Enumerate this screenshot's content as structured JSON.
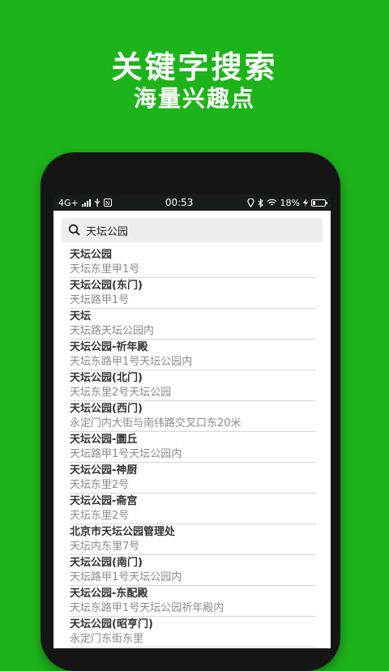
{
  "promo": {
    "headline": "关键字搜索",
    "subline": "海量兴趣点"
  },
  "statusbar": {
    "network": "4G+",
    "time": "00:53",
    "battery": "18%",
    "app_badge": "N"
  },
  "search": {
    "value": "天坛公园"
  },
  "results": [
    {
      "name": "天坛公园",
      "address": "天坛东里甲1号"
    },
    {
      "name": "天坛公园(东门)",
      "address": "天坛路甲1号"
    },
    {
      "name": "天坛",
      "address": "天坛路天坛公园内"
    },
    {
      "name": "天坛公园-祈年殿",
      "address": "天坛东路甲1号天坛公园内"
    },
    {
      "name": "天坛公园(北门)",
      "address": "天坛东里2号天坛公园"
    },
    {
      "name": "天坛公园(西门)",
      "address": "永定门内大街与南纬路交叉口东20米"
    },
    {
      "name": "天坛公园-圜丘",
      "address": "天坛路甲1号天坛公园内"
    },
    {
      "name": "天坛公园-神厨",
      "address": "天坛东里2号"
    },
    {
      "name": "天坛公园-斋宫",
      "address": "天坛东里2号"
    },
    {
      "name": "北京市天坛公园管理处",
      "address": "天坛内东里7号"
    },
    {
      "name": "天坛公园(南门)",
      "address": "天坛路甲1号天坛公园内"
    },
    {
      "name": "天坛公园-东配殿",
      "address": "天坛东路甲1号天坛公园祈年殿内"
    },
    {
      "name": "天坛公园(昭亨门)",
      "address": "永定门东街东里"
    }
  ]
}
